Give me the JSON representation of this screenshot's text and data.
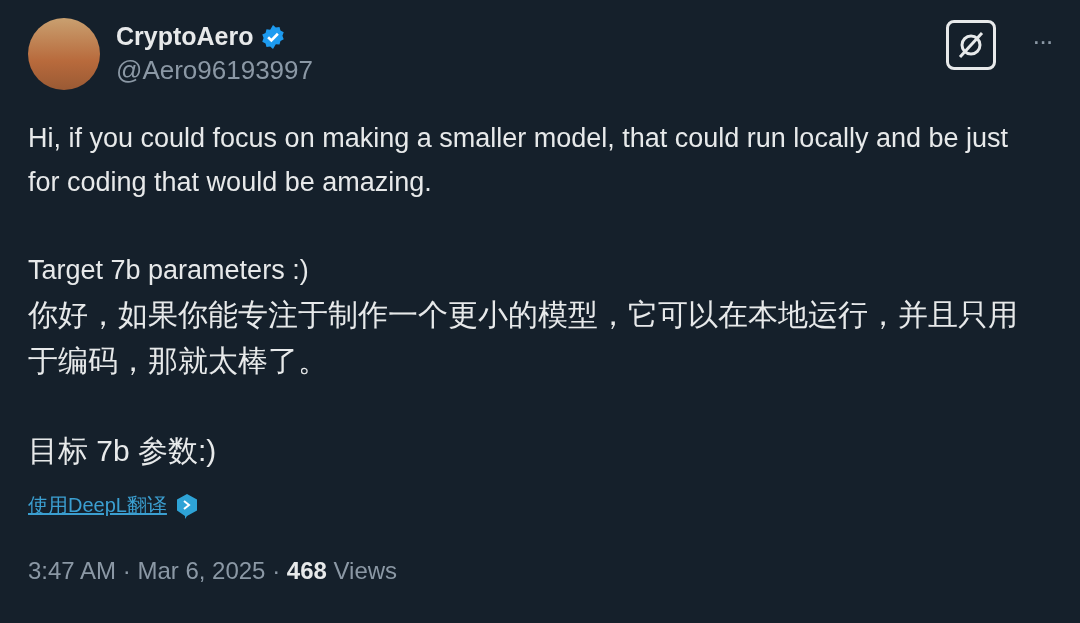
{
  "author": {
    "name": "CryptoAero",
    "handle": "@Aero96193997",
    "verified": true
  },
  "more_button": "···",
  "body": [
    [
      "Hi, if you could focus on making a smaller model, that could run locally and be just for coding that would be amazing.",
      "Target 7b parameters :)"
    ],
    [
      "你好，如果你能专注于制作一个更小的模型，它可以在本地运行，并且只用于编码，那就太棒了。",
      "目标 7b 参数:)"
    ]
  ],
  "translate_link": "使用DeepL翻译",
  "meta": "3:47 AM · Mar 6, 2025 · **468** Views"
}
